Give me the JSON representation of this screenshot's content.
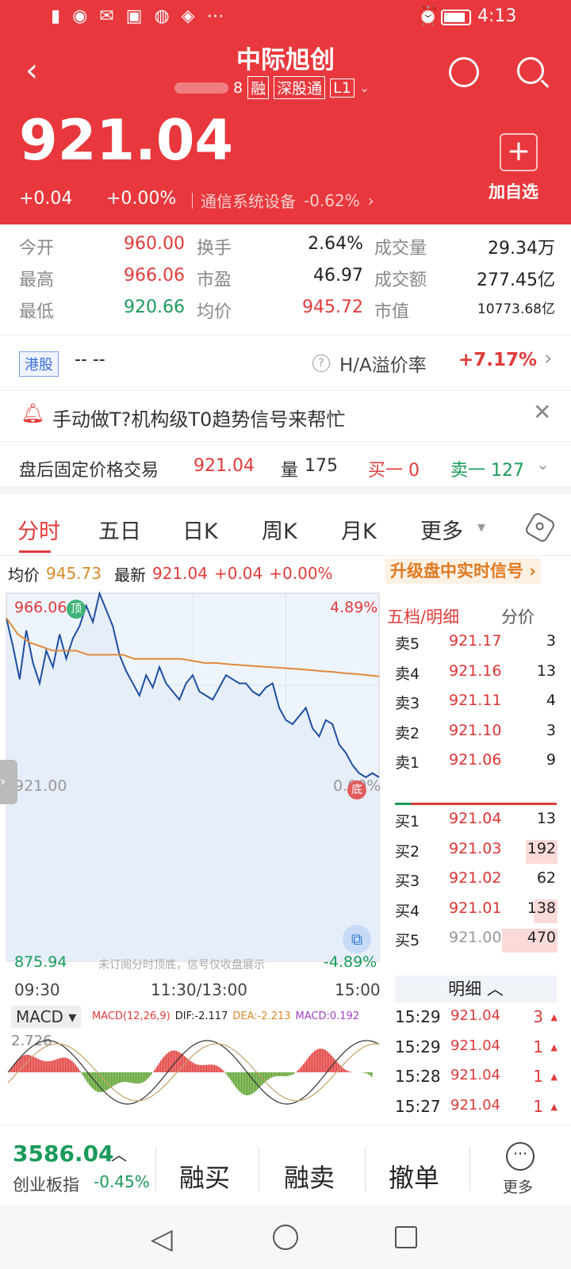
{
  "status": {
    "time": "4:13"
  },
  "header": {
    "title": "中际旭创",
    "code_suffix": "8",
    "tags": [
      "融",
      "深股通",
      "L1"
    ]
  },
  "price": {
    "current": "921.04",
    "change": "+0.04",
    "change_pct": "+0.00%",
    "sector": "通信系统设备",
    "sector_change": "-0.62%",
    "add_watch": "加自选"
  },
  "stats": [
    {
      "label": "今开",
      "value": "960.00",
      "color": "red"
    },
    {
      "label": "换手",
      "value": "2.64%",
      "color": "dark"
    },
    {
      "label": "成交量",
      "value": "29.34万",
      "color": "dark"
    },
    {
      "label": "最高",
      "value": "966.06",
      "color": "red"
    },
    {
      "label": "市盈",
      "value": "46.97",
      "color": "dark"
    },
    {
      "label": "成交额",
      "value": "277.45亿",
      "color": "dark"
    },
    {
      "label": "最低",
      "value": "920.66",
      "color": "green"
    },
    {
      "label": "均价",
      "value": "945.72",
      "color": "red"
    },
    {
      "label": "市值",
      "value": "10773.68亿",
      "color": "dark"
    }
  ],
  "hk": {
    "badge": "港股",
    "value": "-- --",
    "premium_label": "H/A溢价率",
    "premium": "+7.17%"
  },
  "promo": {
    "text": "手动做T?机构级T0趋势信号来帮忙"
  },
  "after_hours": {
    "label": "盘后固定价格交易",
    "price": "921.04",
    "vol_label": "量",
    "vol": "175",
    "bid": "买一 0",
    "ask": "卖一 127"
  },
  "tabs": [
    "分时",
    "五日",
    "日K",
    "周K",
    "月K",
    "更多"
  ],
  "info_bar": {
    "avg_label": "均价",
    "avg": "945.73",
    "latest_label": "最新",
    "latest": "921.04",
    "chg": "+0.04",
    "pct": "+0.00%",
    "upgrade": "升级盘中实时信号"
  },
  "chart_data": {
    "type": "line",
    "x_ticks": [
      "09:30",
      "11:30/13:00",
      "15:00"
    ],
    "y_high": "966.06",
    "y_high_pct": "4.89%",
    "y_mid": "921.00",
    "y_mid_pct": "0.00%",
    "y_low": "875.94",
    "y_low_pct": "-4.89%",
    "ylim": [
      875.94,
      966.06
    ],
    "watermark": "未订阅分时顶底，信号仅收盘展示",
    "top_marker": "顶",
    "bottom_marker": "底",
    "series": [
      {
        "values": [
          960,
          953,
          945,
          957,
          949,
          944,
          952,
          948,
          956,
          950,
          955,
          958,
          963,
          959,
          966,
          962,
          958,
          951,
          947,
          944,
          941,
          946,
          943,
          948,
          944,
          942,
          940,
          944,
          946,
          942,
          941,
          940,
          943,
          946,
          945,
          944,
          944,
          942,
          941,
          943,
          944,
          938,
          935,
          934,
          936,
          938,
          933,
          931,
          935,
          934,
          929,
          927,
          924,
          922,
          921,
          922,
          921
        ]
      },
      {
        "values": [
          960,
          956,
          954,
          953,
          952,
          952,
          952,
          951,
          951,
          951,
          951,
          950,
          950,
          950,
          950,
          950,
          949.5,
          949,
          949,
          948.7,
          948.5,
          948.3,
          948.1,
          947.9,
          947.7,
          947.5,
          947.3,
          947,
          946.8,
          946.5,
          946.3,
          946,
          945.7
        ]
      }
    ]
  },
  "order_book": {
    "tabs": [
      "五档/明细",
      "分价"
    ],
    "asks": [
      {
        "l": "卖5",
        "p": "921.17",
        "q": "3"
      },
      {
        "l": "卖4",
        "p": "921.16",
        "q": "13"
      },
      {
        "l": "卖3",
        "p": "921.11",
        "q": "4"
      },
      {
        "l": "卖2",
        "p": "921.10",
        "q": "3"
      },
      {
        "l": "卖1",
        "p": "921.06",
        "q": "9"
      }
    ],
    "bids": [
      {
        "l": "买1",
        "p": "921.04",
        "q": "13"
      },
      {
        "l": "买2",
        "p": "921.03",
        "q": "192"
      },
      {
        "l": "买3",
        "p": "921.02",
        "q": "62"
      },
      {
        "l": "买4",
        "p": "921.01",
        "q": "138"
      },
      {
        "l": "买5",
        "p": "921.00",
        "q": "470"
      }
    ],
    "detail_label": "明细",
    "ticks": [
      {
        "t": "15:29",
        "p": "921.04",
        "q": "3"
      },
      {
        "t": "15:29",
        "p": "921.04",
        "q": "1"
      },
      {
        "t": "15:28",
        "p": "921.04",
        "q": "1"
      },
      {
        "t": "15:27",
        "p": "921.04",
        "q": "1"
      }
    ]
  },
  "macd": {
    "label": "MACD",
    "params": "MACD(12,26,9)",
    "dif": "DIF:-2.117",
    "dea": "DEA:-2.213",
    "macd": "MACD:0.192",
    "axis": "2.726"
  },
  "bottom": {
    "index_value": "3586.04",
    "index_name": "创业板指",
    "index_chg": "-0.45%",
    "btn_buy": "融买",
    "btn_sell": "融卖",
    "btn_cancel": "撤单",
    "more": "更多"
  }
}
